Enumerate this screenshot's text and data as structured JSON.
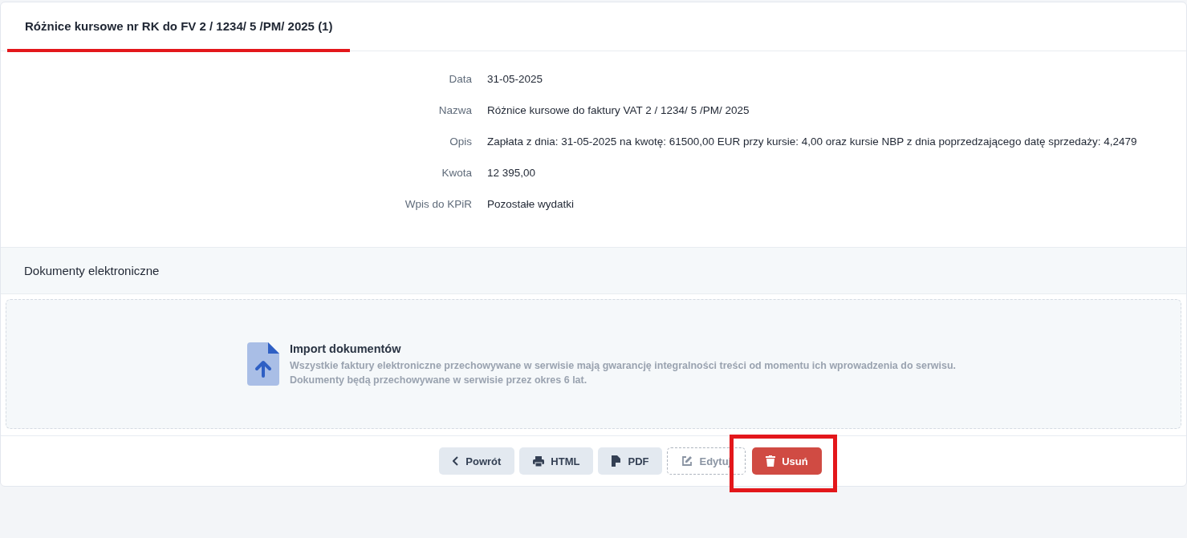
{
  "tabs": [
    {
      "label": "Różnice kursowe nr RK do FV 2 / 1234/ 5 /PM/ 2025 (1)",
      "selected": true
    }
  ],
  "details": [
    {
      "label": "Data",
      "value": "31-05-2025"
    },
    {
      "label": "Nazwa",
      "value": "Różnice kursowe do faktury VAT 2 / 1234/ 5 /PM/ 2025"
    },
    {
      "label": "Opis",
      "value": "Zapłata z dnia: 31-05-2025 na kwotę: 61500,00 EUR przy kursie: 4,00 oraz kursie NBP z dnia poprzedzającego datę sprzedaży: 4,2479"
    },
    {
      "label": "Kwota",
      "value": "12 395,00"
    },
    {
      "label": "Wpis do KPiR",
      "value": "Pozostałe wydatki"
    }
  ],
  "documents": {
    "heading": "Dokumenty elektroniczne",
    "import_title": "Import dokumentów",
    "import_lines": [
      "Wszystkie faktury elektroniczne przechowywane w serwisie mają gwarancję integralności treści od momentu ich wprowadzenia do serwisu.",
      "Dokumenty będą przechowywane w serwisie przez okres 6 lat."
    ]
  },
  "buttons": [
    {
      "kind": "back",
      "label": "Powrót"
    },
    {
      "kind": "print",
      "label": "HTML"
    },
    {
      "kind": "pdf",
      "label": "PDF"
    },
    {
      "kind": "edit",
      "label": "Edytuj"
    },
    {
      "kind": "delete",
      "label": "Usuń"
    }
  ]
}
